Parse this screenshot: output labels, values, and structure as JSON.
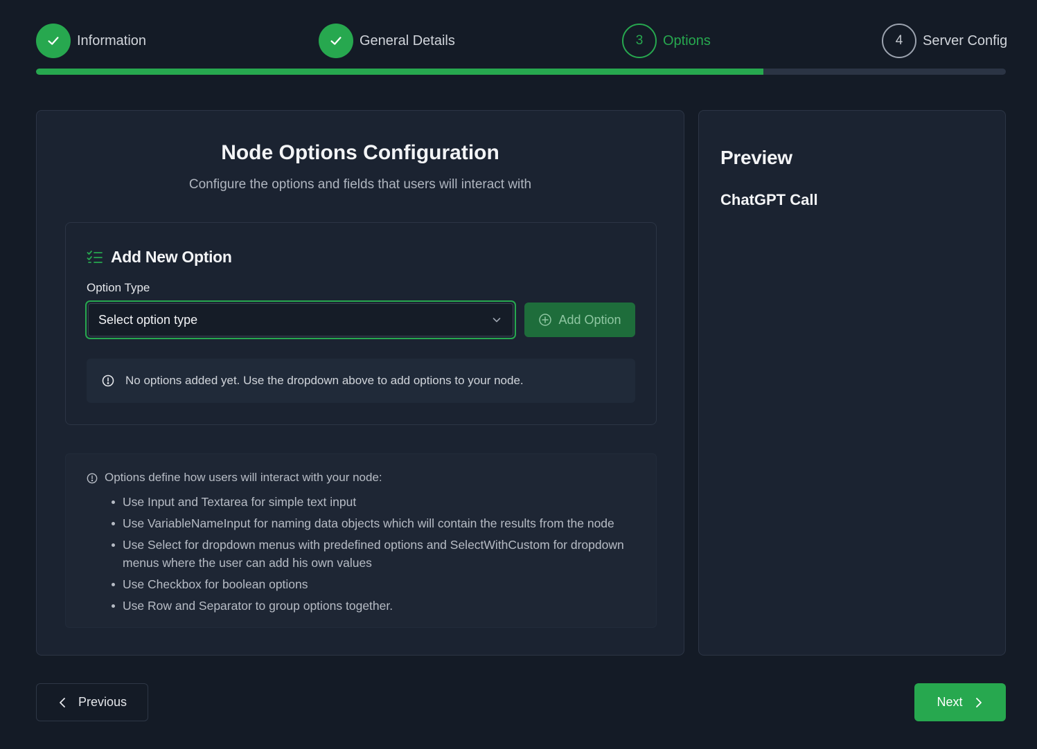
{
  "stepper": {
    "steps": [
      {
        "label": "Information",
        "status": "completed",
        "number": "1",
        "icon": "check-icon"
      },
      {
        "label": "General Details",
        "status": "completed",
        "number": "2",
        "icon": "check-icon"
      },
      {
        "label": "Options",
        "status": "active",
        "number": "3"
      },
      {
        "label": "Server Config",
        "status": "pending",
        "number": "4"
      }
    ],
    "progress_fraction": 0.75
  },
  "main": {
    "title": "Node Options Configuration",
    "subtitle": "Configure the options and fields that users will interact with",
    "add_option": {
      "title": "Add New Option",
      "icon": "list-check-icon",
      "option_type_label": "Option Type",
      "select_value": "Select option type",
      "add_button_label": "Add Option",
      "empty_message": "No options added yet. Use the dropdown above to add options to your node."
    },
    "help": {
      "intro": "Options define how users will interact with your node:",
      "items": [
        "Use Input and Textarea for simple text input",
        "Use VariableNameInput for naming data objects which will contain the results from the node",
        "Use Select for dropdown menus with predefined options and SelectWithCustom for dropdown menus where the user can add his own values",
        "Use Checkbox for boolean options",
        "Use Row and Separator to group options together."
      ]
    }
  },
  "preview": {
    "title": "Preview",
    "node_name": "ChatGPT Call"
  },
  "footer": {
    "previous_label": "Previous",
    "next_label": "Next"
  },
  "colors": {
    "accent": "#27a84f",
    "background": "#141b26",
    "card": "#1b2331",
    "pending": "#9ca3af"
  }
}
